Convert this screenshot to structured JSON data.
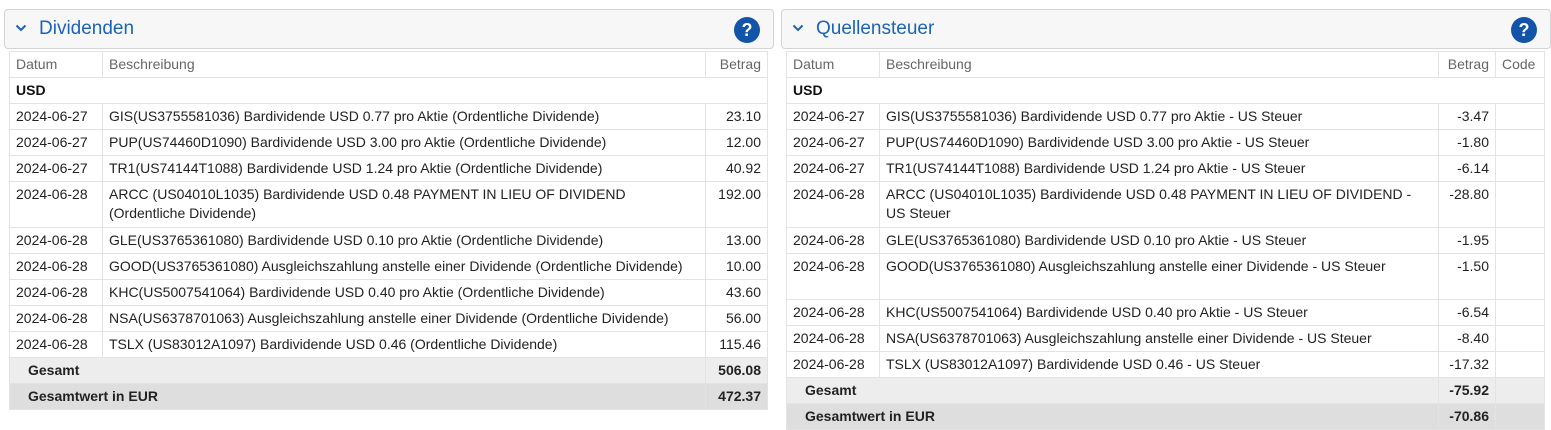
{
  "dividenden": {
    "title": "Dividenden",
    "help": "?",
    "columns": {
      "datum": "Datum",
      "beschreibung": "Beschreibung",
      "betrag": "Betrag"
    },
    "currency": "USD",
    "rows": [
      {
        "datum": "2024-06-27",
        "beschreibung": "GIS(US3755581036) Bardividende USD 0.77 pro Aktie (Ordentliche Dividende)",
        "betrag": "23.10"
      },
      {
        "datum": "2024-06-27",
        "beschreibung": "PUP(US74460D1090) Bardividende USD 3.00 pro Aktie (Ordentliche Dividende)",
        "betrag": "12.00"
      },
      {
        "datum": "2024-06-27",
        "beschreibung": "TR1(US74144T1088) Bardividende USD 1.24 pro Aktie (Ordentliche Dividende)",
        "betrag": "40.92"
      },
      {
        "datum": "2024-06-28",
        "beschreibung": "ARCC (US04010L1035) Bardividende USD 0.48 PAYMENT IN LIEU OF DIVIDEND (Ordentliche Dividende)",
        "betrag": "192.00"
      },
      {
        "datum": "2024-06-28",
        "beschreibung": "GLE(US3765361080) Bardividende USD 0.10 pro Aktie (Ordentliche Dividende)",
        "betrag": "13.00"
      },
      {
        "datum": "2024-06-28",
        "beschreibung": "GOOD(US3765361080) Ausgleichszahlung anstelle einer Dividende (Ordentliche Dividende)",
        "betrag": "10.00"
      },
      {
        "datum": "2024-06-28",
        "beschreibung": "KHC(US5007541064) Bardividende USD 0.40 pro Aktie (Ordentliche Dividende)",
        "betrag": "43.60"
      },
      {
        "datum": "2024-06-28",
        "beschreibung": "NSA(US6378701063) Ausgleichszahlung anstelle einer Dividende (Ordentliche Dividende)",
        "betrag": "56.00"
      },
      {
        "datum": "2024-06-28",
        "beschreibung": "TSLX (US83012A1097) Bardividende USD 0.46 (Ordentliche Dividende)",
        "betrag": "115.46"
      }
    ],
    "gesamt_label": "Gesamt",
    "gesamt": "506.08",
    "gesamt_eur_label": "Gesamtwert in EUR",
    "gesamt_eur": "472.37"
  },
  "quellensteuer": {
    "title": "Quellensteuer",
    "help": "?",
    "columns": {
      "datum": "Datum",
      "beschreibung": "Beschreibung",
      "betrag": "Betrag",
      "code": "Code"
    },
    "currency": "USD",
    "rows": [
      {
        "datum": "2024-06-27",
        "beschreibung": "GIS(US3755581036) Bardividende USD 0.77 pro Aktie - US Steuer",
        "betrag": "-3.47"
      },
      {
        "datum": "2024-06-27",
        "beschreibung": "PUP(US74460D1090) Bardividende USD 3.00 pro Aktie - US Steuer",
        "betrag": "-1.80"
      },
      {
        "datum": "2024-06-27",
        "beschreibung": "TR1(US74144T1088) Bardividende USD 1.24 pro Aktie - US Steuer",
        "betrag": "-6.14"
      },
      {
        "datum": "2024-06-28",
        "beschreibung": "ARCC (US04010L1035) Bardividende USD 0.48 PAYMENT IN LIEU OF DIVIDEND - US Steuer",
        "betrag": "-28.80"
      },
      {
        "datum": "2024-06-28",
        "beschreibung": "GLE(US3765361080) Bardividende USD 0.10 pro Aktie - US Steuer",
        "betrag": "-1.95"
      },
      {
        "datum": "2024-06-28",
        "beschreibung": "GOOD(US3765361080) Ausgleichszahlung anstelle einer Dividende - US Steuer",
        "betrag": "-1.50"
      },
      {
        "datum": "2024-06-28",
        "beschreibung": "KHC(US5007541064) Bardividende USD 0.40 pro Aktie - US Steuer",
        "betrag": "-6.54"
      },
      {
        "datum": "2024-06-28",
        "beschreibung": "NSA(US6378701063) Ausgleichszahlung anstelle einer Dividende - US Steuer",
        "betrag": "-8.40"
      },
      {
        "datum": "2024-06-28",
        "beschreibung": "TSLX (US83012A1097) Bardividende USD 0.46 - US Steuer",
        "betrag": "-17.32"
      }
    ],
    "gesamt_label": "Gesamt",
    "gesamt": "-75.92",
    "gesamt_eur_label": "Gesamtwert in EUR",
    "gesamt_eur": "-70.86"
  }
}
